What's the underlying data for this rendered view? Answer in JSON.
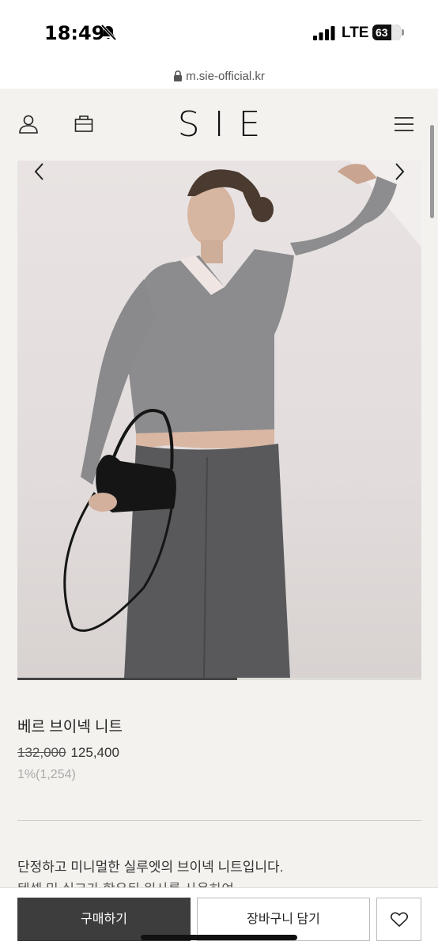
{
  "status_bar": {
    "time": "18:49",
    "network": "LTE",
    "battery": "63"
  },
  "browser": {
    "url": "m.sie-official.kr"
  },
  "header": {
    "logo": "SIE",
    "icons": [
      "user-icon",
      "bag-icon",
      "menu-icon"
    ]
  },
  "gallery": {
    "progress": 0.545,
    "prev_icon": "chevron-left-icon",
    "next_icon": "chevron-right-icon"
  },
  "product": {
    "name": "베르 브이넥 니트",
    "original_price": "132,000",
    "sale_price": "125,400",
    "points": "1%(1,254)",
    "description_line1": "단정하고 미니멀한 실루엣의 브이넥 니트입니다.",
    "description_line2": "텐셀 및 실크가 함유된 원사를 사용하여"
  },
  "actions": {
    "buy_label": "구매하기",
    "cart_label": "장바구니 담기",
    "wish_icon": "heart-icon"
  },
  "colors": {
    "background": "#f3f2ee",
    "buy_button": "#3d3d3d"
  }
}
